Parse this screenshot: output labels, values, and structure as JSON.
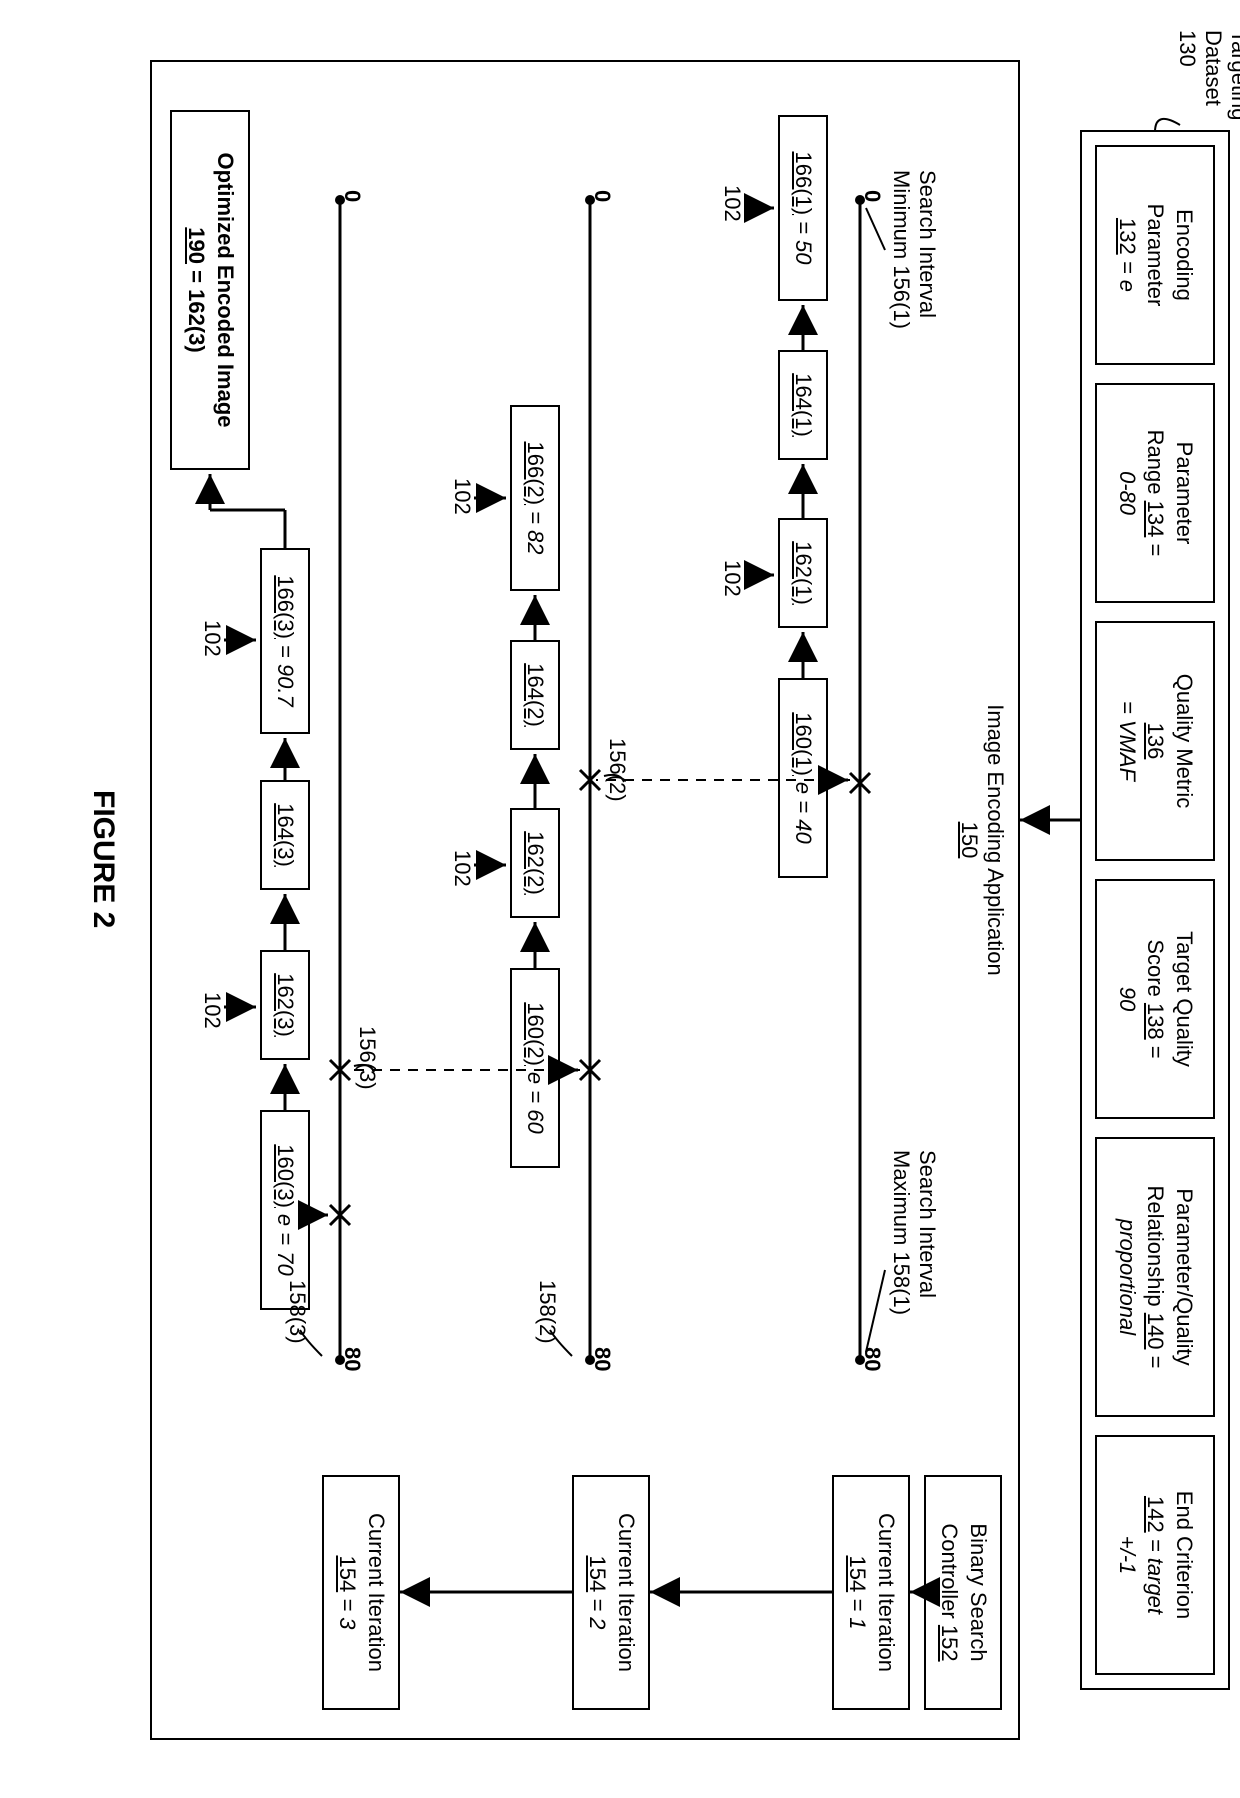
{
  "targeting_dataset": {
    "label_line1": "Targeting",
    "label_line2": "Dataset",
    "ref": "130",
    "encoding_parameter": {
      "l1": "Encoding",
      "l2": "Parameter",
      "ref": "132",
      "val": "= e"
    },
    "parameter_range": {
      "l1": "Parameter",
      "l2": "Range",
      "ref": "134",
      "val": "=",
      "val2": "0-80"
    },
    "quality_metric": {
      "l1": "Quality Metric",
      "ref": "136",
      "val": "= VMAF"
    },
    "target_quality": {
      "l1": "Target Quality",
      "l2": "Score",
      "ref": "138",
      "val": "=",
      "val2": "90"
    },
    "pq_relationship": {
      "l1": "Parameter/Quality",
      "l2": "Relationship",
      "ref": "140",
      "val": "=",
      "val2": "proportional"
    },
    "end_criterion": {
      "l1": "End Criterion",
      "ref": "142",
      "val": "= target",
      "val2": "+/-1"
    }
  },
  "app": {
    "label": "Image Encoding Application",
    "ref": "150"
  },
  "bsc": {
    "label": "Binary Search",
    "label2": "Controller",
    "ref": "152"
  },
  "iter": {
    "label": "Current Iteration",
    "ref": "154",
    "v1": "= 1",
    "v2": "= 2",
    "v3": "= 3"
  },
  "si_min": {
    "label": "Search Interval",
    "label2": "Minimum 156(1)"
  },
  "si_max": {
    "label": "Search Interval",
    "label2": "Maximum 158(1)"
  },
  "axis": {
    "min": "0",
    "max": "80"
  },
  "refs102": "102",
  "r1": {
    "b160": "160(1)",
    "b160v": "e = 40",
    "b162": "162(1)",
    "b164": "164(1)",
    "b166": "166(1)",
    "b166v": "= 50"
  },
  "r2": {
    "min": "156(2)",
    "max": "158(2)",
    "b160": "160(2)",
    "b160v": "e = 60",
    "b162": "162(2)",
    "b164": "164(2)",
    "b166": "166(2)",
    "b166v": "= 82"
  },
  "r3": {
    "min": "156(3)",
    "max": "158(3)",
    "b160": "160(3)",
    "b160v": "e = 70",
    "b162": "162(3)",
    "b164": "164(3)",
    "b166": "166(3)",
    "b166v": "= 90.7"
  },
  "result": {
    "l1": "Optimized Encoded Image",
    "ref": "190",
    "val": "= 162(3)"
  },
  "figure": "FIGURE 2"
}
